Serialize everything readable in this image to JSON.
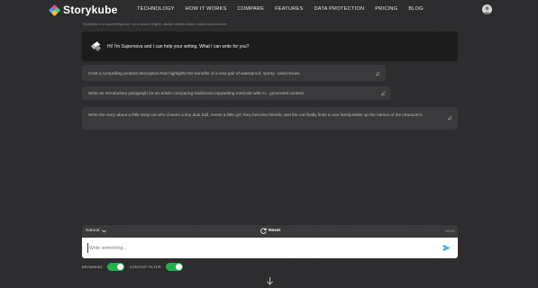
{
  "brand": {
    "name": "Storykube"
  },
  "nav": {
    "items": [
      "TECHNOLOGY",
      "HOW IT WORKS",
      "COMPARE",
      "FEATURES",
      "DATA PROTECTION",
      "PRICING",
      "BLOG"
    ]
  },
  "disclaimer": "Storykube is a copywriting tool, not a search engine, always double-check content and sources.",
  "assistant": {
    "greeting": "Hi! I'm Supernova and I can help your writing. What I can write for you?"
  },
  "prompts": [
    "Craft a compelling product description that highlights the benefits of a new pair of waterproof, sporty- soled shoes.",
    "Write an introductory paragraph for an article comparing traditional copywriting methods with AI - generated content.",
    "Write the story about a little stray cat who chases a tiny dust ball, meets a little girl, they become friends, and the cat finally finds a new family.Make up the names of the characters."
  ],
  "composer": {
    "tone": "Natural",
    "reset_label": "Reset",
    "char_count": "0/2000",
    "placeholder": "Write something..."
  },
  "toggles": {
    "browsing": {
      "label": "BROWSING",
      "on": true
    },
    "content_filter": {
      "label": "CONTENT FILTER",
      "on": true
    }
  },
  "colors": {
    "toggle_on": "#22b04b",
    "send_icon": "#29a8e0",
    "logo_blue": "#3fa9f5",
    "logo_green": "#3ecf8e",
    "logo_pink": "#e94c89",
    "logo_yellow": "#f5c242"
  },
  "icons": {
    "avatar": "user-avatar-icon",
    "edit": "pencil-icon",
    "reset": "refresh-icon",
    "send": "send-icon",
    "scroll": "arrow-down-icon",
    "dropdown": "chevron-down-icon"
  }
}
